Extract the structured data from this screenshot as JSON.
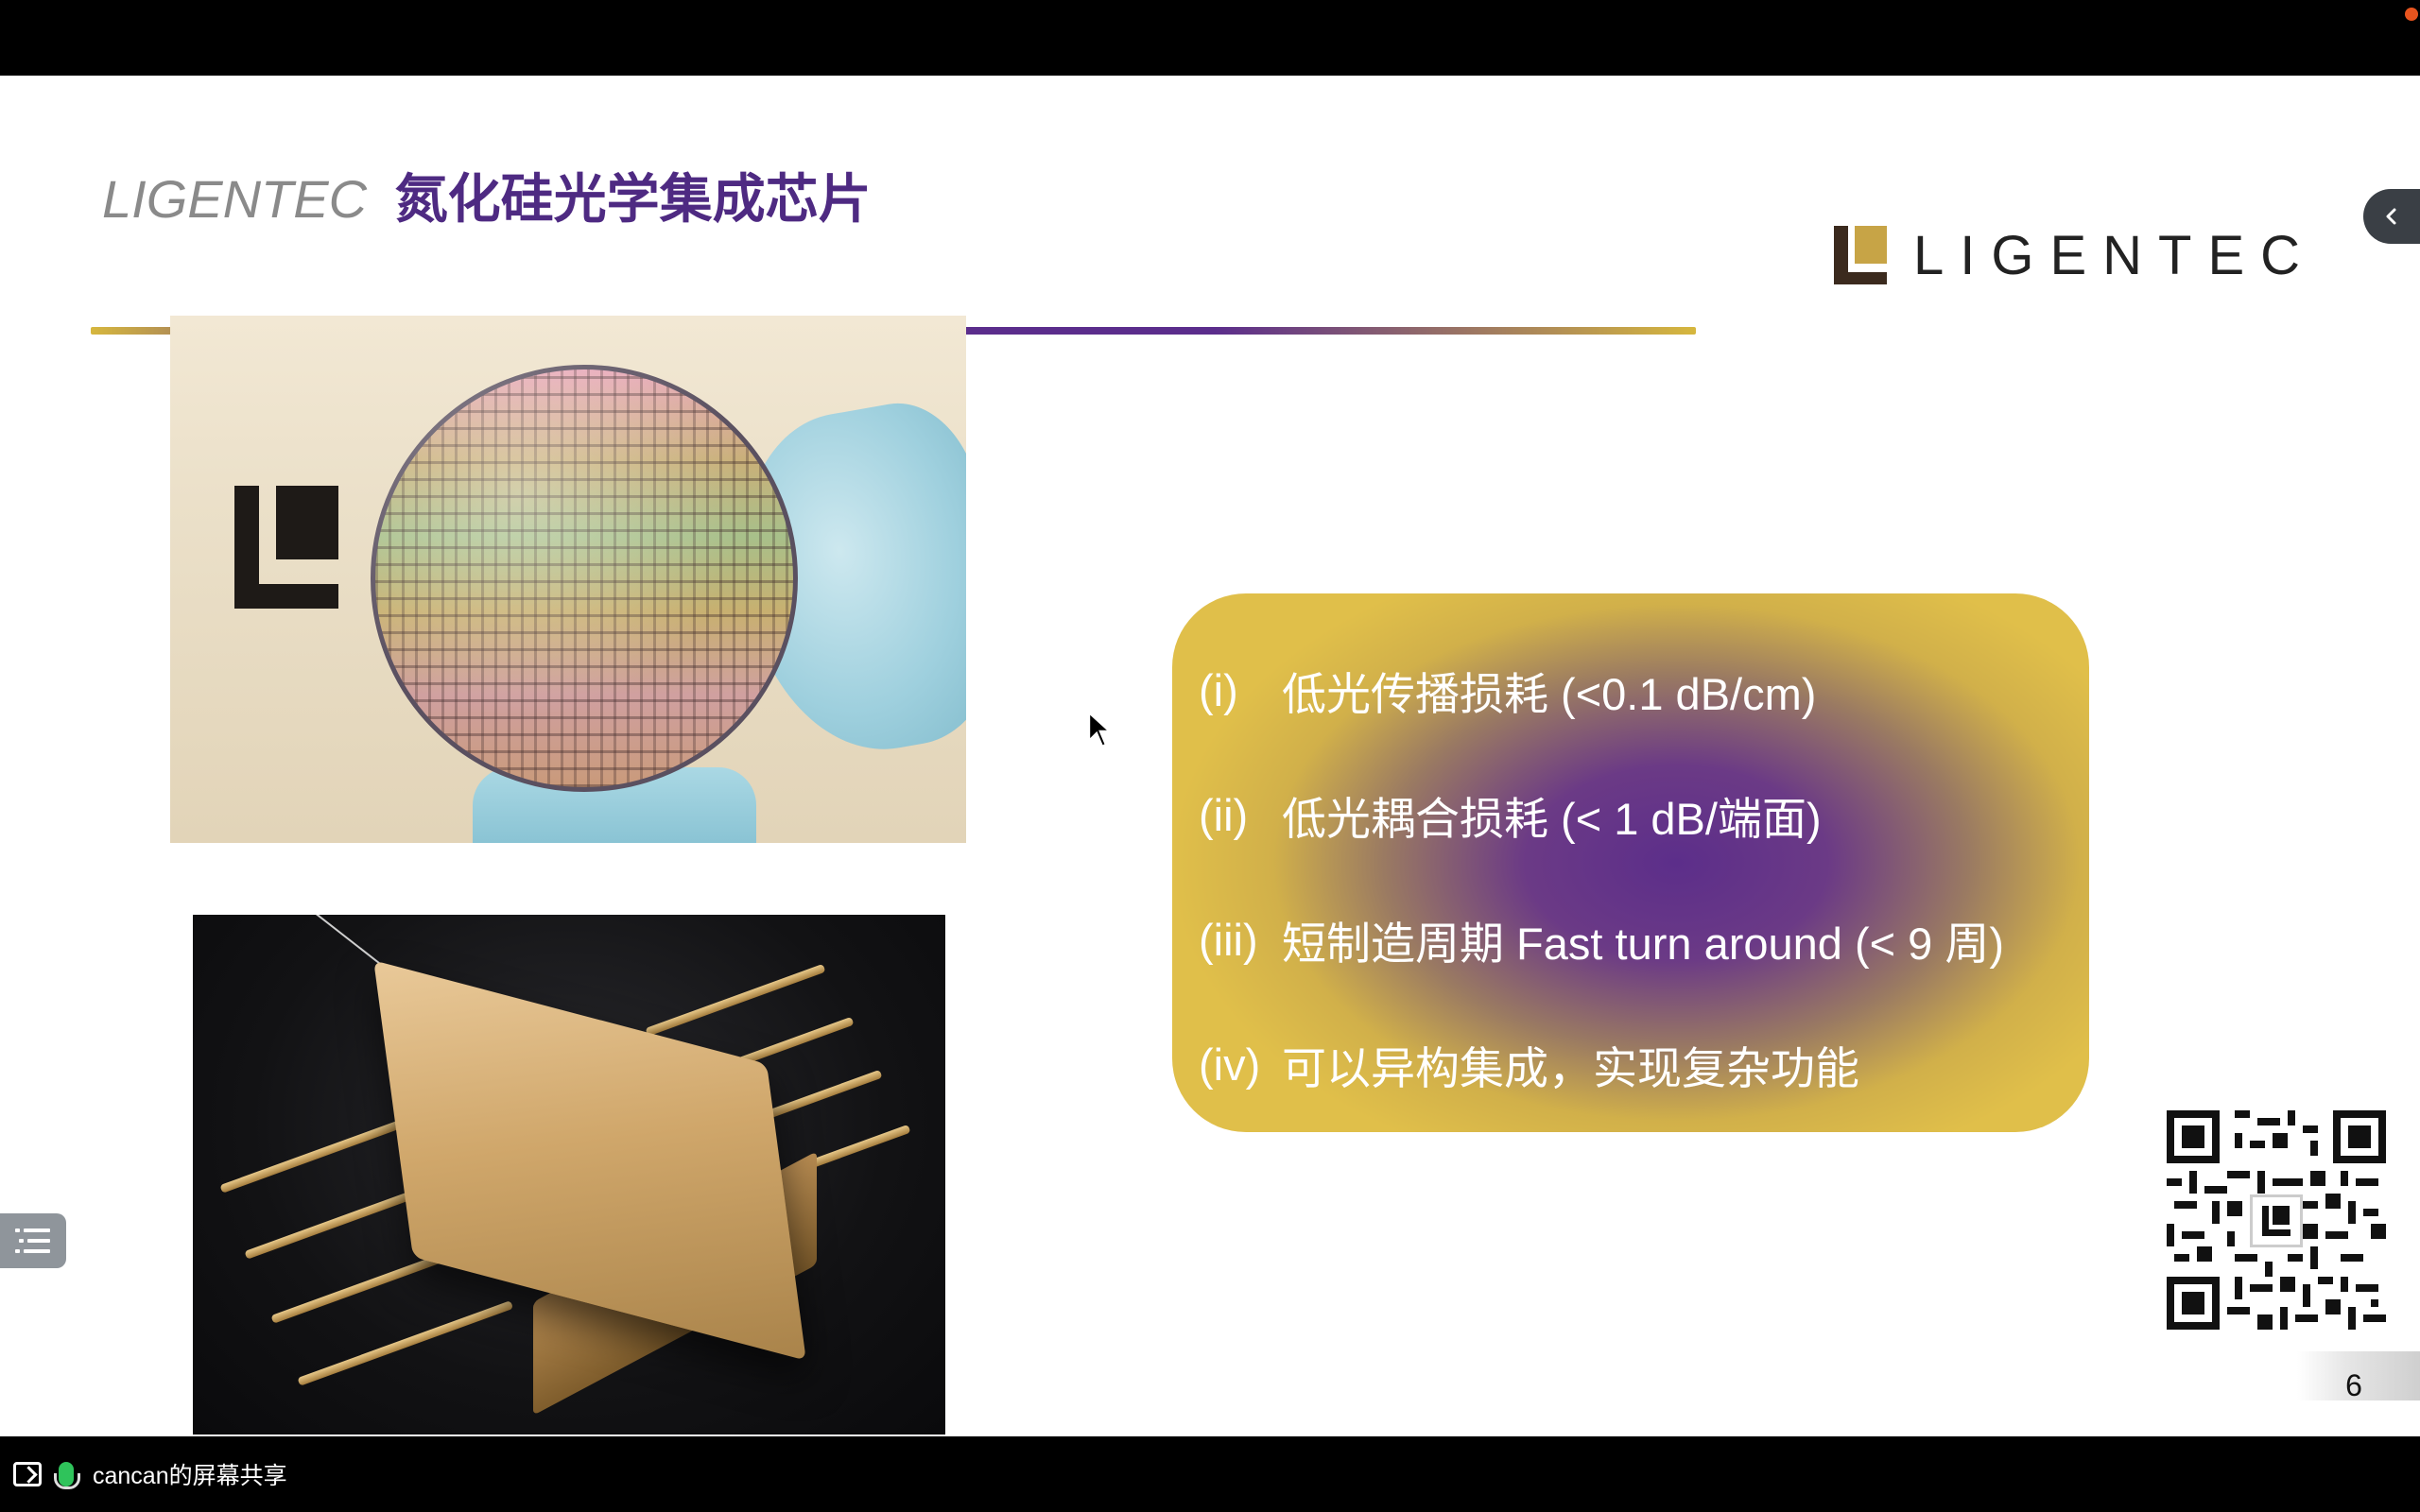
{
  "slide": {
    "title_en": "LIGENTEC",
    "title_cn": "氮化硅光学集成芯片",
    "brand_logo_text": "LIGENTEC",
    "features": [
      {
        "num": "(i)",
        "text": "低光传播损耗 (<0.1 dB/cm)"
      },
      {
        "num": "(ii)",
        "text": "低光耦合损耗 (< 1 dB/端面)"
      },
      {
        "num": "(iii)",
        "text": "短制造周期 Fast turn around (< 9 周)"
      },
      {
        "num": "(iv)",
        "text": "可以异构集成，实现复杂功能"
      }
    ],
    "page_number": "6",
    "colors": {
      "title_purple": "#4e2a82",
      "rule_gold": "#d6b73e",
      "rule_purple": "#5b2d8c",
      "box_gold": "#e0bf4a",
      "box_purple": "#5c2e8a"
    }
  },
  "viewer": {
    "collapse_icon": "chevron-left-icon",
    "toc_icon": "list-icon"
  },
  "footer": {
    "share_label": "cancan的屏幕共享",
    "share_icon": "screen-share-icon",
    "mic_icon": "microphone-icon"
  }
}
